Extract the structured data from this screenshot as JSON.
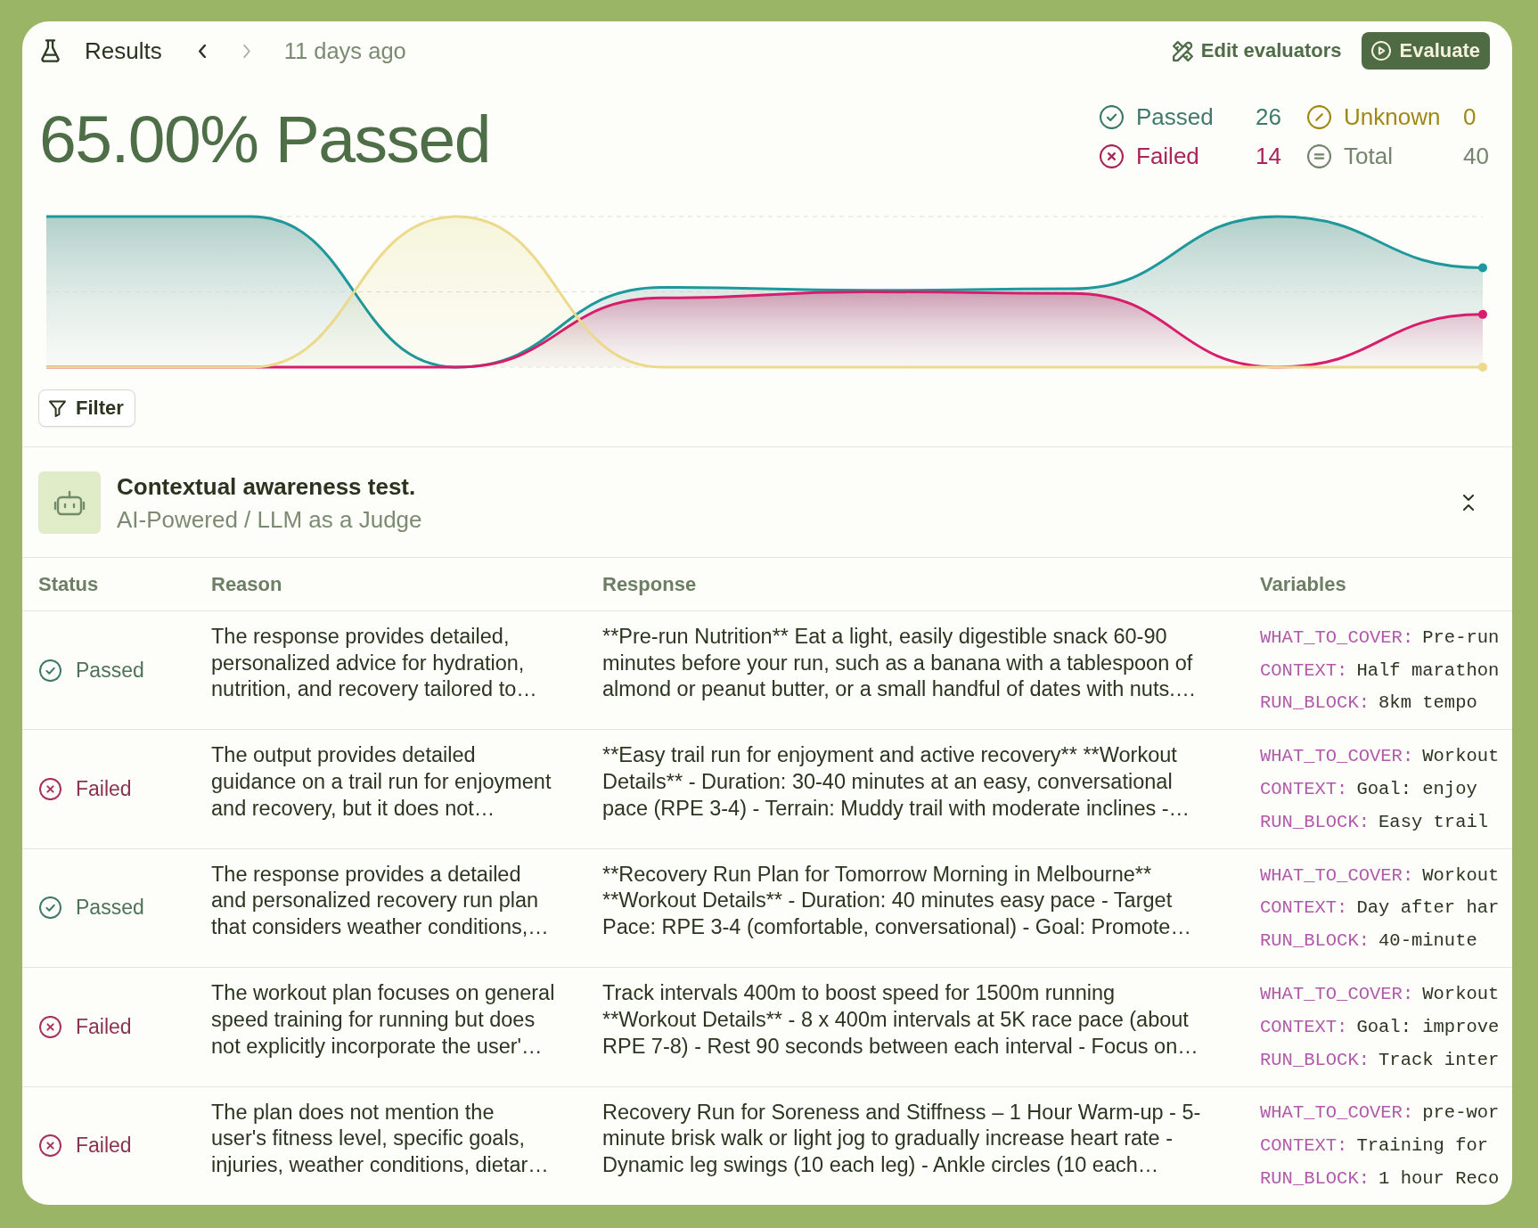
{
  "header": {
    "title": "Results",
    "nav": [
      {
        "kind": "previous",
        "disabled": false
      },
      {
        "kind": "next",
        "disabled": true
      }
    ],
    "timestamp": "11 days ago",
    "actions": [
      {
        "kind": "edit",
        "label": "Edit evaluators"
      },
      {
        "kind": "run",
        "label": "Evaluate"
      }
    ]
  },
  "summary": {
    "headline": "65.00% Passed",
    "stats": [
      {
        "kind": "passed",
        "label": "Passed",
        "value": "26"
      },
      {
        "kind": "unknown",
        "label": "Unknown",
        "value": "0"
      },
      {
        "kind": "failed",
        "label": "Failed",
        "value": "14"
      },
      {
        "kind": "total",
        "label": "Total",
        "value": "40"
      }
    ]
  },
  "filter": {
    "label": "Filter"
  },
  "evaluator": {
    "title": "Contextual awareness test.",
    "subtitle": "AI-Powered / LLM as a Judge",
    "expanded": true
  },
  "table": {
    "columns": [
      "Status",
      "Reason",
      "Response",
      "Variables"
    ],
    "rows": [
      {
        "status": {
          "label": "Passed",
          "kind": "passed"
        },
        "reason": "The response provides detailed,\npersonalized advice for hydration,\nnutrition, and recovery tailored to…",
        "response": "**Pre-run Nutrition** Eat a light, easily digestible snack 60-90\nminutes before your run, such as a banana with a tablespoon of\nalmond or peanut butter, or a small handful of dates with nuts.…",
        "variables": [
          {
            "name": "WHAT_TO_COVER:",
            "value": "Pre-run"
          },
          {
            "name": "CONTEXT:",
            "value": "Half marathon"
          },
          {
            "name": "RUN_BLOCK:",
            "value": "8km tempo"
          }
        ]
      },
      {
        "status": {
          "label": "Failed",
          "kind": "failed"
        },
        "reason": "The output provides detailed\nguidance on a trail run for enjoyment\nand recovery, but it does not…",
        "response": "**Easy trail run for enjoyment and active recovery** **Workout\nDetails** - Duration: 30-40 minutes at an easy, conversational\npace (RPE 3-4) - Terrain: Muddy trail with moderate inclines -…",
        "variables": [
          {
            "name": "WHAT_TO_COVER:",
            "value": "Workout"
          },
          {
            "name": "CONTEXT:",
            "value": "Goal: enjoy"
          },
          {
            "name": "RUN_BLOCK:",
            "value": "Easy trail"
          }
        ]
      },
      {
        "status": {
          "label": "Passed",
          "kind": "passed"
        },
        "reason": "The response provides a detailed\nand personalized recovery run plan\nthat considers weather conditions,…",
        "response": "**Recovery Run Plan for Tomorrow Morning in Melbourne**\n**Workout Details** - Duration: 40 minutes easy pace - Target\nPace: RPE 3-4 (comfortable, conversational) - Goal: Promote…",
        "variables": [
          {
            "name": "WHAT_TO_COVER:",
            "value": "Workout"
          },
          {
            "name": "CONTEXT:",
            "value": "Day after har"
          },
          {
            "name": "RUN_BLOCK:",
            "value": "40-minute"
          }
        ]
      },
      {
        "status": {
          "label": "Failed",
          "kind": "failed"
        },
        "reason": "The workout plan focuses on general\nspeed training for running but does\nnot explicitly incorporate the user'…",
        "response": "Track intervals 400m to boost speed for 1500m running\n**Workout Details** - 8 x 400m intervals at 5K race pace (about\nRPE 7-8) - Rest 90 seconds between each interval - Focus on…",
        "variables": [
          {
            "name": "WHAT_TO_COVER:",
            "value": "Workout"
          },
          {
            "name": "CONTEXT:",
            "value": "Goal: improve"
          },
          {
            "name": "RUN_BLOCK:",
            "value": "Track inter"
          }
        ]
      },
      {
        "status": {
          "label": "Failed",
          "kind": "failed"
        },
        "reason": "The plan does not mention the\nuser's fitness level, specific goals,\ninjuries, weather conditions, dietar…",
        "response": "Recovery Run for Soreness and Stiffness – 1 Hour Warm-up - 5-\nminute brisk walk or light jog to gradually increase heart rate -\nDynamic leg swings (10 each leg) - Ankle circles (10 each…",
        "variables": [
          {
            "name": "WHAT_TO_COVER:",
            "value": "pre-wor"
          },
          {
            "name": "CONTEXT:",
            "value": "Training for"
          },
          {
            "name": "RUN_BLOCK:",
            "value": "1 hour Reco"
          }
        ]
      }
    ]
  }
}
